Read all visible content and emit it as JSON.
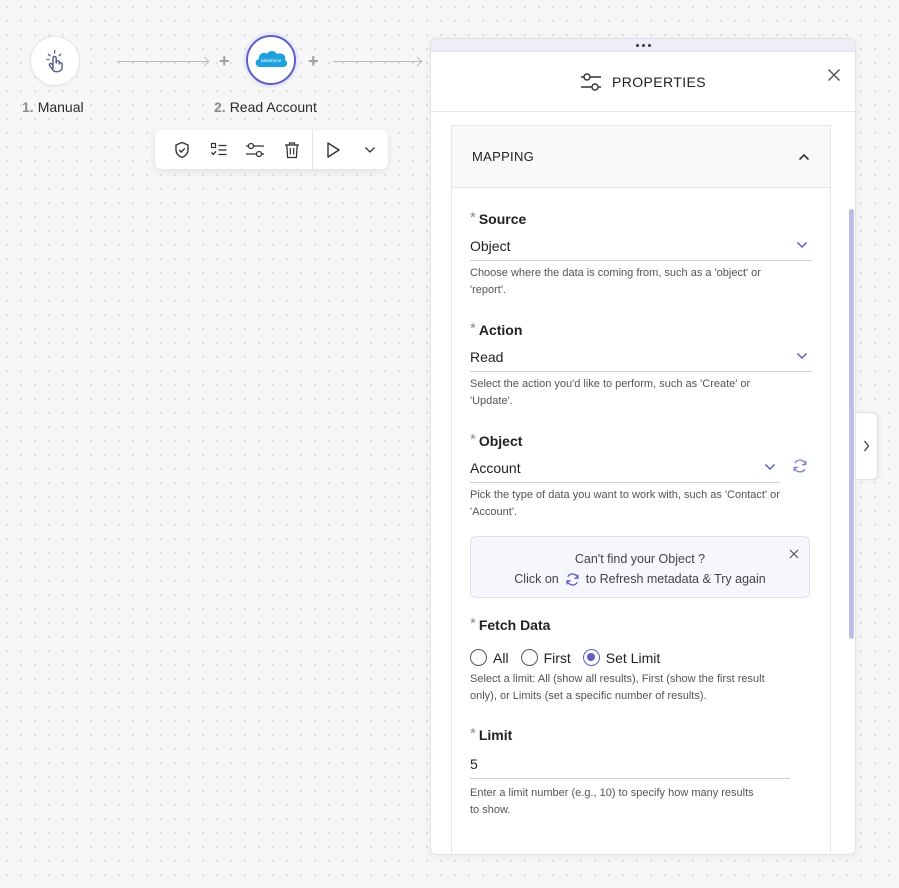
{
  "canvas": {
    "nodes": [
      {
        "number": "1.",
        "label": "Manual",
        "icon": "pointer-click-icon"
      },
      {
        "number": "2.",
        "label": "Read Account",
        "icon": "salesforce-logo",
        "logo_text": "salesforce"
      }
    ],
    "toolbar": {
      "buttons": [
        "shield-check-icon",
        "checklist-icon",
        "sliders-icon",
        "trash-icon",
        "play-icon",
        "chevron-down-icon"
      ]
    }
  },
  "panel": {
    "title": "PROPERTIES",
    "section": {
      "title": "MAPPING",
      "fields": {
        "source": {
          "label": "Source",
          "value": "Object",
          "help": "Choose where the data is coming from, such as a 'object' or 'report'."
        },
        "action": {
          "label": "Action",
          "value": "Read",
          "help": "Select the action you'd like to perform, such as 'Create' or 'Update'."
        },
        "object": {
          "label": "Object",
          "value": "Account",
          "help": "Pick the type of data you want to work with, such as 'Contact' or 'Account'."
        },
        "fetch": {
          "label": "Fetch Data",
          "options": [
            "All",
            "First",
            "Set Limit"
          ],
          "selected": "Set Limit",
          "help": "Select a limit: All (show all results), First (show the first result only), or Limits (set a specific number of results)."
        },
        "limit": {
          "label": "Limit",
          "value": "5",
          "help": "Enter a limit number (e.g., 10) to specify how many results to show."
        }
      },
      "notice": {
        "line1": "Can't find your Object ?",
        "line2_pre": "Click on",
        "line2_post": "to Refresh metadata & Try again"
      }
    }
  },
  "colors": {
    "accent": "#5b5fc7",
    "salesforce": "#1ea0de"
  }
}
